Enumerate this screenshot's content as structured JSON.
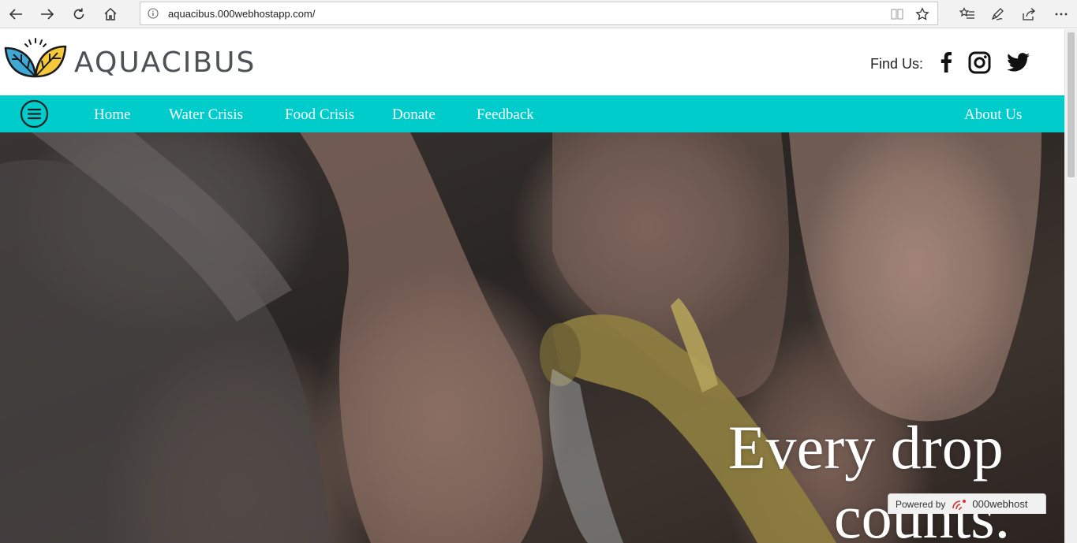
{
  "browser": {
    "url": "aquacibus.000webhostapp.com/"
  },
  "site": {
    "logo_text": "AQUACIBUS",
    "find_us_label": "Find Us:",
    "social": [
      "facebook-icon",
      "instagram-icon",
      "twitter-icon"
    ]
  },
  "nav": {
    "items": [
      "Home",
      "Water Crisis",
      "Food Crisis",
      "Donate",
      "Feedback"
    ],
    "about": "About Us"
  },
  "hero": {
    "title_line1": "Every drop",
    "title_line2": "counts."
  },
  "badge": {
    "prefix": "Powered by",
    "brand": "000webhost"
  },
  "colors": {
    "nav_bg": "#00cccc",
    "logo_blue": "#3fa9d6",
    "logo_yellow": "#f5c93a",
    "logo_text": "#4e5156"
  }
}
